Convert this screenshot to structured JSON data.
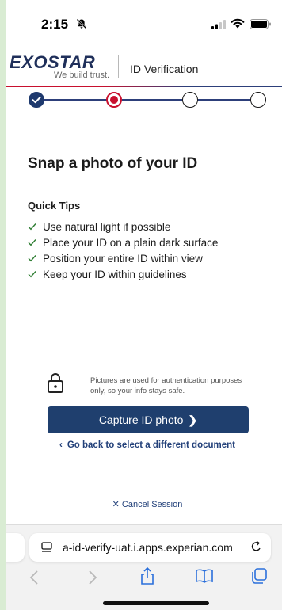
{
  "status_bar": {
    "time": "2:15"
  },
  "header": {
    "logo_text": "EXOSTAR",
    "logo_tagline": "We build trust.",
    "title": "ID Verification"
  },
  "stepper": {
    "steps": [
      "done",
      "current",
      "pending",
      "pending"
    ]
  },
  "main": {
    "title": "Snap a photo of your ID",
    "tips_heading": "Quick Tips",
    "tips": [
      "Use natural light if possible",
      "Place your ID on a plain dark surface",
      "Position your entire ID within view",
      "Keep your ID within guidelines"
    ],
    "notice": "Pictures are used for authentication purposes only, so your info stays safe.",
    "capture_button": "Capture ID photo",
    "back_link": "Go back to select a different document",
    "cancel_link": "Cancel Session"
  },
  "browser": {
    "url": "a-id-verify-uat.i.apps.experian.com"
  },
  "colors": {
    "brand_navy": "#1f3f6e",
    "accent_red": "#c8102e",
    "check_green": "#2e7d32"
  }
}
